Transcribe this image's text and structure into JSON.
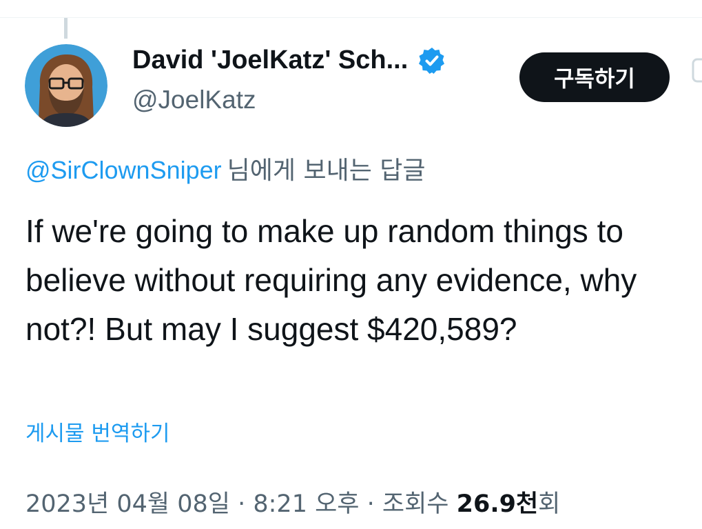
{
  "author": {
    "name": "David 'JoelKatz' Sch...",
    "handle": "@JoelKatz",
    "verified_icon": "verified-badge-icon",
    "avatar_icon": "avatar-illustration"
  },
  "actions": {
    "subscribe_label": "구독하기"
  },
  "reply": {
    "mention": "@SirClownSniper",
    "suffix": "님에게 보내는 답글"
  },
  "tweet": {
    "text": "If we're going to make up random things to believe without requiring any evidence, why not?! But may I suggest $420,589?"
  },
  "translate_label": "게시물 번역하기",
  "meta": {
    "timestamp": "2023년 04월 08일 · 8:21 오후 · 조회수 ",
    "views_count": "26.9천",
    "views_suffix": "회"
  },
  "colors": {
    "accent": "#1d9bf0",
    "text_primary": "#0f1419",
    "text_secondary": "#536471",
    "button_bg": "#0f1419"
  }
}
